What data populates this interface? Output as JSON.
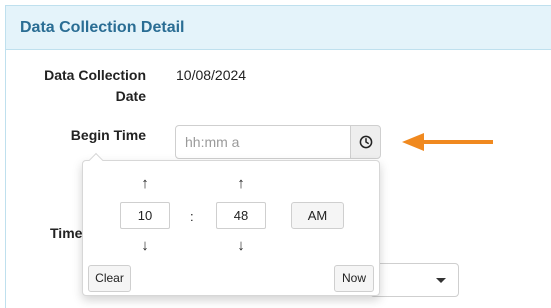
{
  "panel": {
    "title": "Data Collection Detail"
  },
  "fields": {
    "date": {
      "label_line1": "Data Collection",
      "label_line2": "Date",
      "value": "10/08/2024"
    },
    "begin_time": {
      "label": "Begin Time",
      "placeholder": "hh:mm a"
    },
    "partial_label": "Time"
  },
  "picker": {
    "hour": "10",
    "separator": ":",
    "minute": "48",
    "meridiem": "AM",
    "up_symbol": "↑",
    "down_symbol": "↓",
    "clear_label": "Clear",
    "now_label": "Now"
  },
  "colors": {
    "accent": "#2a6d94",
    "header_bg": "#e4f3fa",
    "annotation_arrow": "#f0891f"
  },
  "icons": {
    "time_button": "clock-icon",
    "annotation": "arrow-left-icon",
    "select": "caret-down-icon"
  }
}
